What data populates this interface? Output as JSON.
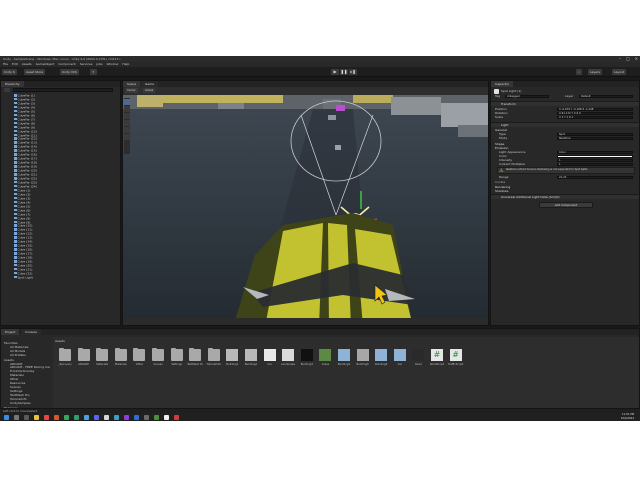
{
  "window": {
    "title": "Unity - SampleScene - Windows, Mac, Linux - Unity 6.0 (6000.0.23f1) <DX11>"
  },
  "menu": [
    "File",
    "Edit",
    "Assets",
    "GameObject",
    "Component",
    "Services",
    "Jobs",
    "Window",
    "Help"
  ],
  "toolbar": {
    "account": "Unity 6",
    "asset_store": "Asset Store",
    "version_control": "Unity VCS",
    "layers": "Layers",
    "layout": "Layout"
  },
  "hierarchy": {
    "title": "Hierarchy",
    "items": [
      "CubeFar (1)",
      "CubeFar (2)",
      "CubeFar (3)",
      "CubeFar (4)",
      "CubeFar (5)",
      "CubeFar (6)",
      "CubeFar (7)",
      "CubeFar (8)",
      "CubeFar (9)",
      "CubeFar (10)",
      "CubeFar (11)",
      "CubeFar (12)",
      "CubeFar (13)",
      "CubeFar (14)",
      "CubeFar (15)",
      "CubeFar (16)",
      "CubeFar (17)",
      "CubeFar (18)",
      "CubeFar (19)",
      "CubeFar (20)",
      "CubeFar (21)",
      "CubeFar (22)",
      "CubeFar (23)",
      "CubeFar (24)",
      "Cube (1)",
      "Cube (2)",
      "Cube (3)",
      "Cube (4)",
      "Cube (5)",
      "Cube (6)",
      "Cube (7)",
      "Cube (8)",
      "Cube (9)",
      "Cube (10)",
      "Cube (11)",
      "Cube (12)",
      "Cube (13)",
      "Cube (14)",
      "Cube (15)",
      "Cube (16)",
      "Cube (17)",
      "Cube (18)",
      "Cube (19)",
      "Cube (20)",
      "Cube (21)",
      "Cube (22)",
      "Spot Light"
    ]
  },
  "scene": {
    "tab_scene": "Scene",
    "tab_game": "Game",
    "mode": "Center",
    "space": "Global"
  },
  "inspector": {
    "title": "Inspector",
    "object_name": "Spot Light (1)",
    "tag": "Untagged",
    "layer": "Default",
    "transform": {
      "label": "Transform",
      "position": "X -0.679   Y -0.188   Z -1.248",
      "rotation": "X 61.172   Y 0   Z 0",
      "scale": "X 1   Y 1   Z 1"
    },
    "light": {
      "label": "Light",
      "general": "General",
      "type_label": "Type",
      "type": "Spot",
      "mode_label": "Mode",
      "mode": "Realtime",
      "shape": "Shape",
      "emission": "Emission",
      "light_appearance_label": "Light Appearance",
      "light_appearance": "Color",
      "color_label": "Color",
      "intensity_label": "Intensity",
      "intensity": "1",
      "range_label": "Range",
      "range": "21.23",
      "indirect_label": "Indirect Multiplier",
      "indirect": "1",
      "warning": "Realtime indirect bounce shadowing is not supported for Spot lights.",
      "cookie": "Cookie",
      "rendering": "Rendering",
      "shadows": "Shadows"
    },
    "additional": "Universal Additional Light Data (Script)",
    "add_component": "Add Component"
  },
  "project": {
    "tab_project": "Project",
    "tab_console": "Console",
    "favorites": [
      "Favorites",
      "All Materials",
      "All Models",
      "All Prefabs"
    ],
    "tree": [
      "Assets",
      "ARCADE",
      "ARCADE - FREE Racing Car",
      "FrontCarOverlay",
      "Materials",
      "Other",
      "Resources",
      "Scenes",
      "Settings",
      "TextMesh Pro",
      "TutorialInfo",
      "UnitySamples",
      "Packages"
    ],
    "breadcrumb": "Assets",
    "assets": [
      "_Recovery",
      "ARCADE",
      "Materials",
      "Materials",
      "Other",
      "Scenes",
      "Settings",
      "TextMesh Pro",
      "TutorialInfo",
      "Building1",
      "Building2",
      "Car",
      "Landscape",
      "Building3",
      "Grass",
      "Building4",
      "Building5",
      "Building6",
      "Car",
      "Road",
      "RoadScript",
      "TrafficScript"
    ]
  },
  "status": {
    "text": "Left-click to move/select"
  },
  "clock": {
    "time": "11:01 PM",
    "date": "10/4/2024"
  },
  "colors": {
    "accent": "#2c5d87",
    "bg": "#191919",
    "panel": "#282828",
    "car_yellow": "#c2c230"
  }
}
